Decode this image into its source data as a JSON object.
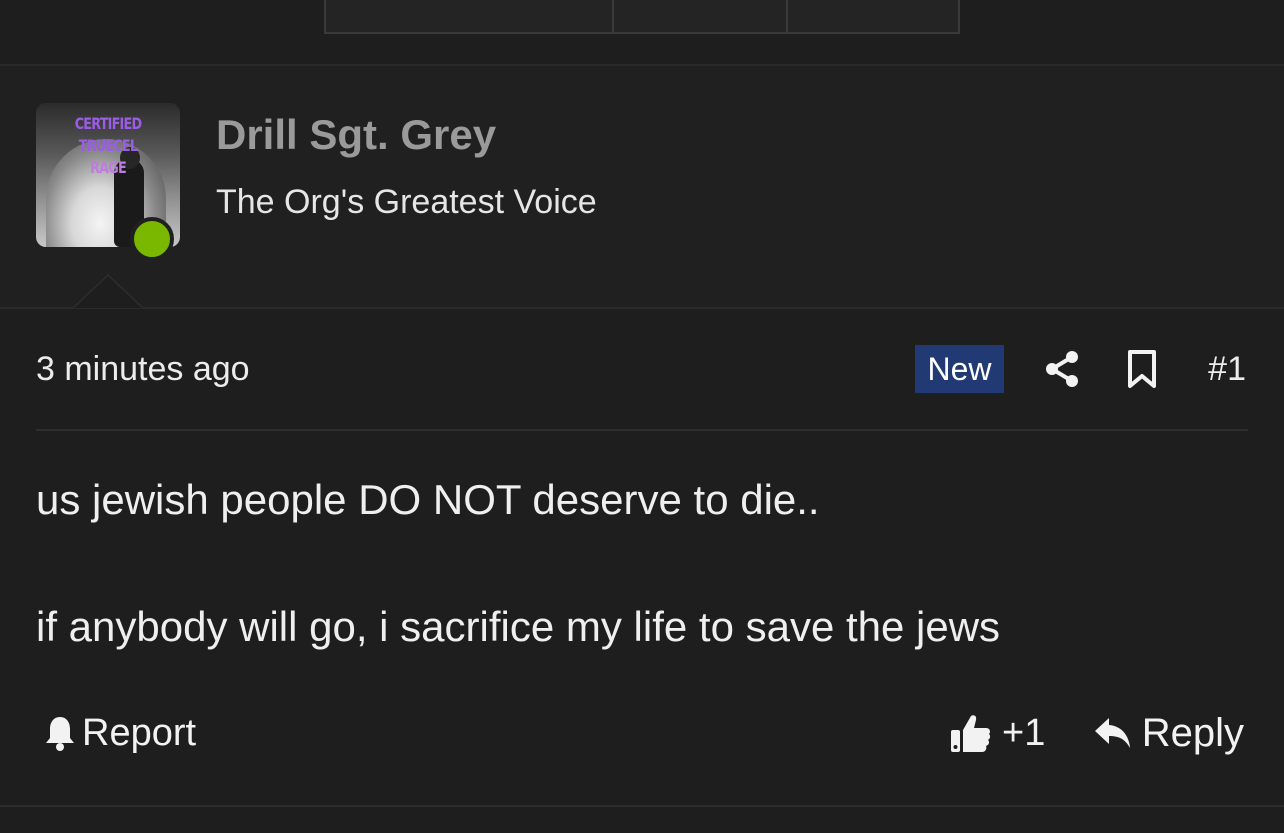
{
  "author": {
    "name": "Drill Sgt. Grey",
    "title": "The Org's Greatest Voice",
    "avatar_text_line1": "CERTIFIED TRUECEL",
    "avatar_text_line2": "RAGE",
    "online": true,
    "online_color": "#7ab800"
  },
  "post": {
    "timestamp": "3 minutes ago",
    "badge": "New",
    "badge_color": "#223a73",
    "number": "#1",
    "body_lines": [
      "us jewish people DO NOT deserve to die..",
      "if anybody will go, i sacrifice my life to save the jews"
    ],
    "actions": {
      "report_label": "Report",
      "like_label": "+1",
      "reply_label": "Reply"
    },
    "icons": {
      "share": "share-icon",
      "bookmark": "bookmark-icon",
      "report": "bell-icon",
      "like": "thumbs-up-icon",
      "reply": "reply-icon"
    }
  }
}
